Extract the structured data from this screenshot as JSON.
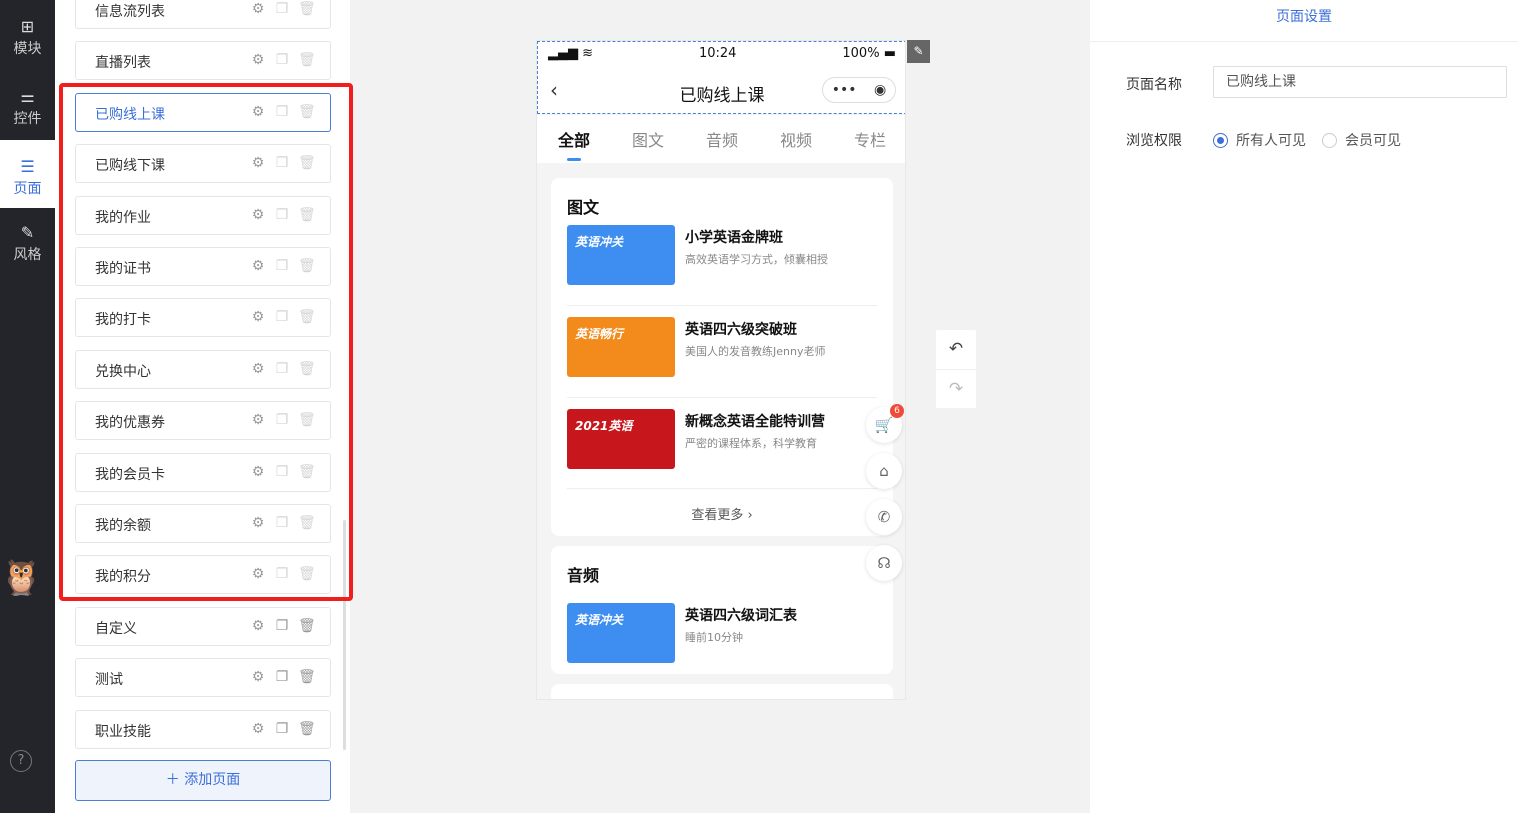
{
  "nav": [
    {
      "label": "模块",
      "icon": "plus-square-icon"
    },
    {
      "label": "控件",
      "icon": "sliders-icon"
    },
    {
      "label": "页面",
      "icon": "pages-icon",
      "active": true
    },
    {
      "label": "风格",
      "icon": "magic-wand-icon"
    }
  ],
  "pages": [
    {
      "label": "信息流列表"
    },
    {
      "label": "直播列表"
    },
    {
      "label": "已购线上课",
      "selected": true
    },
    {
      "label": "已购线下课"
    },
    {
      "label": "我的作业"
    },
    {
      "label": "我的证书"
    },
    {
      "label": "我的打卡"
    },
    {
      "label": "兑换中心"
    },
    {
      "label": "我的优惠券"
    },
    {
      "label": "我的会员卡"
    },
    {
      "label": "我的余额"
    },
    {
      "label": "我的积分"
    },
    {
      "label": "自定义"
    },
    {
      "label": "测试"
    },
    {
      "label": "职业技能"
    }
  ],
  "add_page": "添加页面",
  "help": "?",
  "phone": {
    "time": "10:24",
    "battery": "100%",
    "title": "已购线上课",
    "tabs": [
      "全部",
      "图文",
      "音频",
      "视频",
      "专栏"
    ],
    "sections": [
      {
        "title": "图文",
        "courses": [
          {
            "title": "小学英语金牌班",
            "sub": "高效英语学习方式，倾囊相授",
            "thumb_text": "英语冲关",
            "color": "#3d8ef0"
          },
          {
            "title": "英语四六级突破班",
            "sub": "美国人的发音教练Jenny老师",
            "thumb_text": "英语畅行",
            "color": "#f28a1c"
          },
          {
            "title": "新概念英语全能特训营",
            "sub": "严密的课程体系，科学教育",
            "thumb_text": "2021英语",
            "color": "#c8161d"
          }
        ],
        "more": "查看更多 ›"
      },
      {
        "title": "音频",
        "courses": [
          {
            "title": "英语四六级词汇表",
            "sub": "睡前10分钟",
            "thumb_text": "英语冲关",
            "color": "#3d8ef0"
          }
        ]
      }
    ],
    "cart_badge": "6"
  },
  "settings": {
    "title": "页面设置",
    "name_label": "页面名称",
    "name_value": "已购线上课",
    "perm_label": "浏览权限",
    "options": [
      "所有人可见",
      "会员可见"
    ]
  }
}
